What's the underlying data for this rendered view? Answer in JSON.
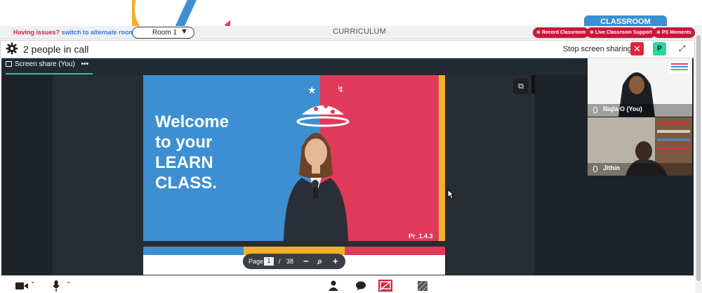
{
  "header": {
    "classroom_tab": "CLASSROOM",
    "issue_text": "Having issues?",
    "issue_link": "switch to alternate room",
    "room_select": "Room 1",
    "curriculum": "CURRICULUM",
    "actions": [
      "Record Classroom",
      "Live Classroom Support",
      "PS Moments"
    ]
  },
  "call": {
    "people_count_text": "2 people in call",
    "stop_share_label": "Stop screen sharing",
    "p_button": "P"
  },
  "share": {
    "tab_label": "Screen share (You)",
    "tab_menu": "•••"
  },
  "slide": {
    "headline_lines": [
      "Welcome",
      "to your",
      "LEARN",
      "CLASS."
    ],
    "code": "Pr_1.4.3"
  },
  "pager": {
    "label": "Page",
    "current": "1",
    "sep": "/",
    "total": "38"
  },
  "participants": [
    {
      "name": "Najla O (You)"
    },
    {
      "name": "Jithin"
    }
  ],
  "colors": {
    "accent_red": "#c8173a",
    "classroom_blue": "#3a8fd1",
    "share_green": "#27c59b",
    "slide_blue": "#3d8fd2",
    "slide_pink": "#e03a5a",
    "slide_yellow": "#f2b12b"
  }
}
